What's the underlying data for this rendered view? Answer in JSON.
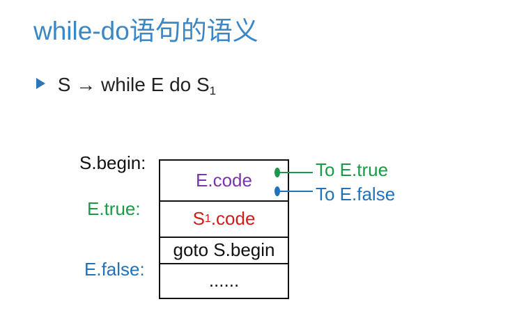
{
  "slide": {
    "title": "while-do语句的语义",
    "rule": {
      "lhs": "S",
      "arrow": "→",
      "rhs": "while E do S",
      "subscript": "1"
    }
  },
  "diagram": {
    "labels": {
      "s_begin": "S.begin:",
      "e_true": "E.true:",
      "e_false": "E.false:"
    },
    "cells": {
      "e_code": "E.code",
      "s1_code_base": "S",
      "s1_code_sub": "1",
      "s1_code_suffix": ".code",
      "goto": "goto S.begin",
      "ellipsis": "......"
    },
    "exits": {
      "to_true": "To E.true",
      "to_false": "To E.false"
    },
    "colors": {
      "title": "#3a87c8",
      "green": "#1a9a48",
      "blue": "#2272b9",
      "purple": "#7a35a8",
      "red": "#d21c1c",
      "black": "#111111"
    }
  }
}
